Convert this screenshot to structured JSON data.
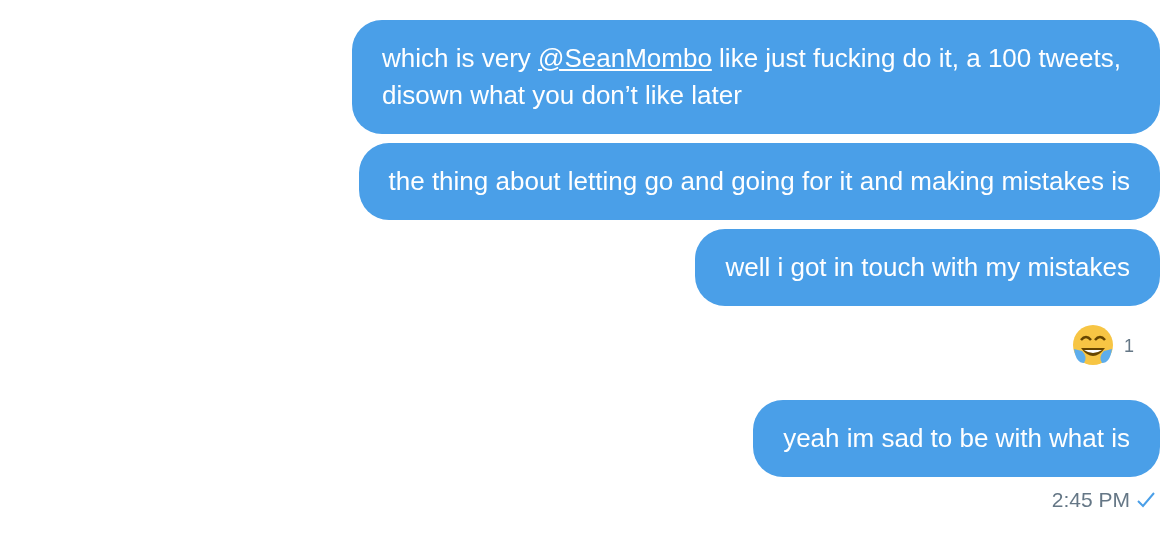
{
  "messages": [
    {
      "segments": [
        {
          "kind": "text",
          "text": "which is very "
        },
        {
          "kind": "mention",
          "text": "@SeanMombo"
        },
        {
          "kind": "text",
          "text": " like just fucking do it, a 100 tweets, disown what you don’t like later"
        }
      ]
    },
    {
      "segments": [
        {
          "kind": "text",
          "text": "the thing about letting go and going for it and making mistakes is"
        }
      ]
    },
    {
      "segments": [
        {
          "kind": "text",
          "text": "well i got in touch with my mistakes"
        }
      ],
      "reaction": {
        "count": "1"
      }
    },
    {
      "segments": [
        {
          "kind": "text",
          "text": "yeah im sad to be with what is"
        }
      ]
    }
  ],
  "footer": {
    "time": "2:45 PM",
    "seen": true
  }
}
